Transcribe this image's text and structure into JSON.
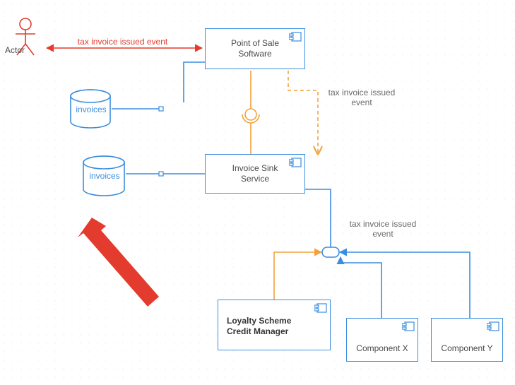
{
  "actor": {
    "label": "Actor"
  },
  "components": {
    "pos": {
      "label": "Point of Sale\nSoftware"
    },
    "sink": {
      "label": "Invoice Sink\nService"
    },
    "loyalty": {
      "label": "Loyalty Scheme\nCredit Manager"
    },
    "compX": {
      "label": "Component X"
    },
    "compY": {
      "label": "Component Y"
    }
  },
  "databases": {
    "db1": {
      "label": "invoices"
    },
    "db2": {
      "label": "invoices"
    }
  },
  "edges": {
    "actorToPos": {
      "label": "tax invoice issued event"
    },
    "posToSinkEvent": {
      "label": "tax invoice issued\nevent"
    },
    "sinkToBroker": {
      "label": "tax invoice issued\nevent"
    }
  },
  "colors": {
    "blue": "#3b8ede",
    "orange": "#f3a13a",
    "red": "#e33b2e",
    "text": "#4a4a4a"
  }
}
